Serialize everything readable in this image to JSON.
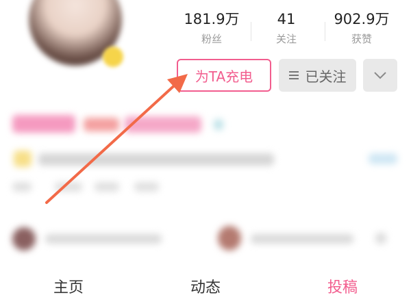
{
  "stats": [
    {
      "value": "181.9万",
      "label": "粉丝"
    },
    {
      "value": "41",
      "label": "关注"
    },
    {
      "value": "902.9万",
      "label": "获赞"
    }
  ],
  "actions": {
    "charge_label": "为TA充电",
    "follow_label": "已关注"
  },
  "tabs": [
    {
      "label": "主页"
    },
    {
      "label": "动态"
    },
    {
      "label": "投稿",
      "active": true
    }
  ],
  "icons": {
    "menu": "menu-lines-icon",
    "more": "chevron-down-icon"
  },
  "colors": {
    "accent": "#f25d8e",
    "annotation_arrow": "#f26a48",
    "button_gray": "#e9e9e9"
  }
}
